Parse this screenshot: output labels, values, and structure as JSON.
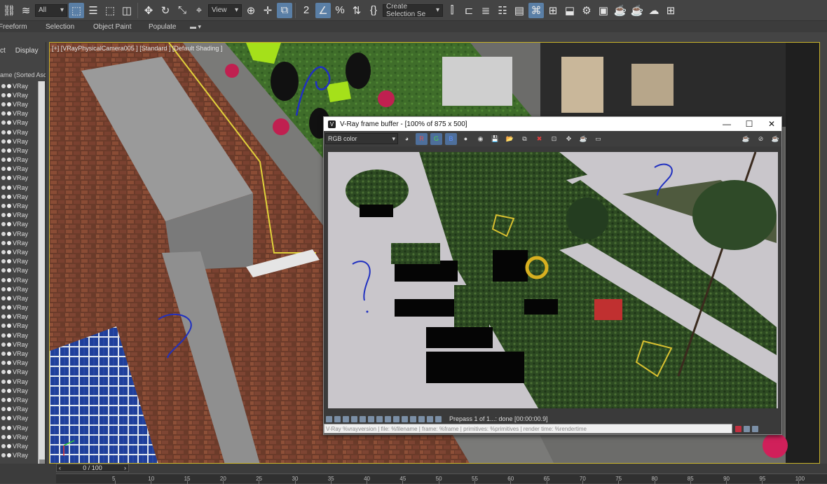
{
  "toolbar": {
    "filter_value": "All",
    "view_value": "View",
    "selection_set_placeholder": "Create Selection Se"
  },
  "ribbon": {
    "tabs": [
      "Freeform",
      "Selection",
      "Object Paint",
      "Populate"
    ]
  },
  "left_panel": {
    "tab_select": "ct",
    "tab_display": "Display",
    "sort_header": "ame (Sorted Ascen",
    "items": [
      "VRay",
      "VRay",
      "VRay",
      "VRay",
      "VRay",
      "VRay",
      "VRay",
      "VRay",
      "VRay",
      "VRay",
      "VRay",
      "VRay",
      "VRay",
      "VRay",
      "VRay",
      "VRay",
      "VRay",
      "VRay",
      "VRay",
      "VRay",
      "VRay",
      "VRay",
      "VRay",
      "VRay",
      "VRay",
      "VRay",
      "VRay",
      "VRay",
      "VRay",
      "VRay",
      "VRay",
      "VRay",
      "VRay",
      "VRay",
      "VRay",
      "VRay",
      "VRay",
      "VRay",
      "VRay",
      "VRay",
      "VRay"
    ],
    "item_suffix": "Ray"
  },
  "viewport": {
    "label": "[+] [VRayPhysicalCamera005 ] [Standard ] [Default Shading ]"
  },
  "frame_buffer": {
    "title": "V-Ray frame buffer - [100% of 875 x 500]",
    "channel": "RGB color",
    "status": "Prepass 1 of 1...: done [00:00:00.9]",
    "stamp": "V-Ray %vrayversion | file: %filename | frame: %frame | primitives: %primitives | render time: %rendertime"
  },
  "timeline": {
    "frame_counter": "0 / 100",
    "ticks": [
      "5",
      "10",
      "15",
      "20",
      "25",
      "30",
      "35",
      "40",
      "45",
      "50",
      "55",
      "60",
      "65",
      "70",
      "75",
      "80",
      "85",
      "90",
      "95",
      "100"
    ]
  },
  "colors": {
    "viewport_border": "#c9b32a",
    "active_icon": "#5a7fa6",
    "annotation_blue": "#2030c0"
  }
}
